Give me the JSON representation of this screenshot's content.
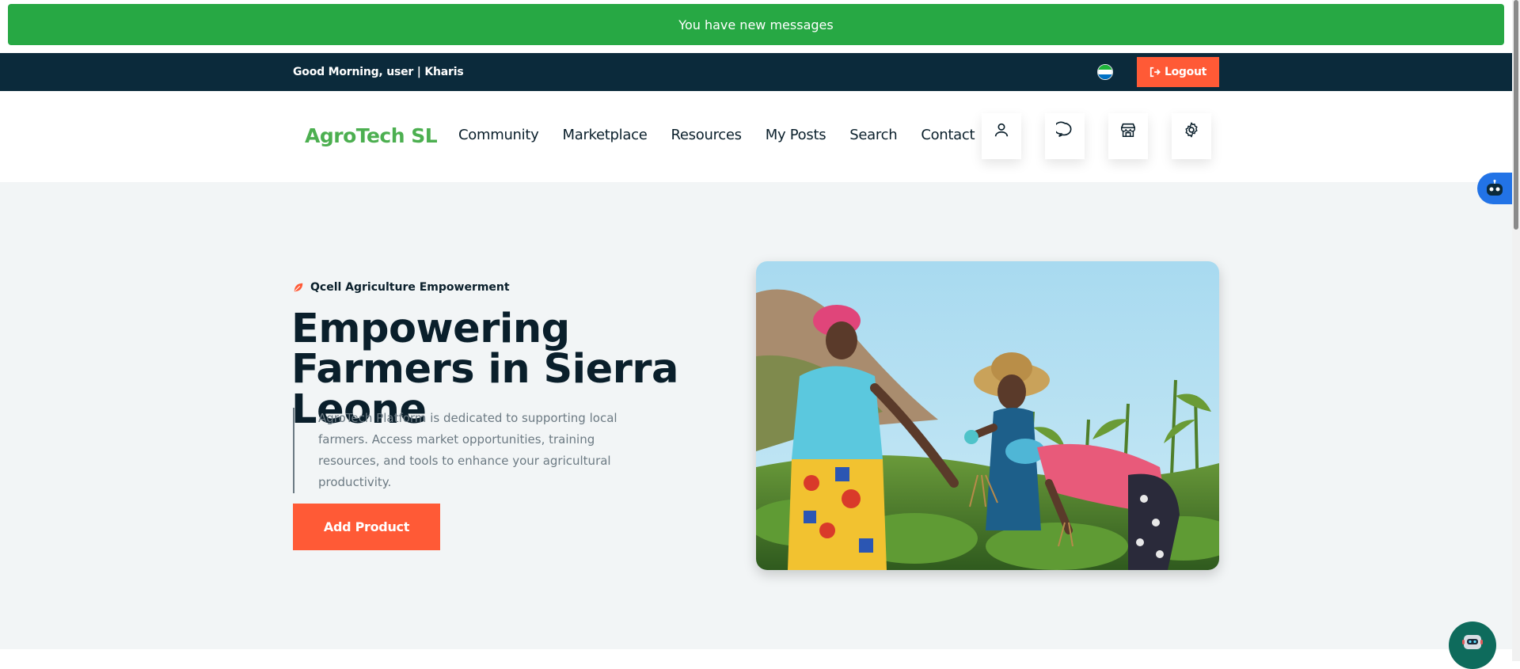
{
  "alert": {
    "text": "You have new messages",
    "color": "#27a844"
  },
  "topbar": {
    "greeting": "Good Morning, user | Kharis",
    "flag_colors": [
      "#1eb53a",
      "#ffffff",
      "#0072c6"
    ],
    "logout_label": "Logout",
    "logout_icon": "sign-out-icon"
  },
  "navbar": {
    "logo": "AgroTech SL",
    "menu": [
      "Community",
      "Marketplace",
      "Resources",
      "My Posts",
      "Search",
      "Contact"
    ],
    "icon_buttons": [
      "user-icon",
      "chat-icon",
      "store-icon",
      "gear-icon"
    ]
  },
  "hero": {
    "tagline": "Qcell Agriculture Empowerment",
    "headline": "Empowering Farmers in Sierra Leone",
    "description": "AgroTech Platform is dedicated to supporting local farmers. Access market opportunities, training resources, and tools to enhance your agricultural productivity.",
    "cta_label": "Add Product",
    "image_icon": "farmers-photo"
  },
  "colors": {
    "brand_green": "#4caf50",
    "accent_orange": "#ff5a36",
    "dark_navy": "#0b2a3b",
    "hero_bg": "#f2f5f6"
  }
}
